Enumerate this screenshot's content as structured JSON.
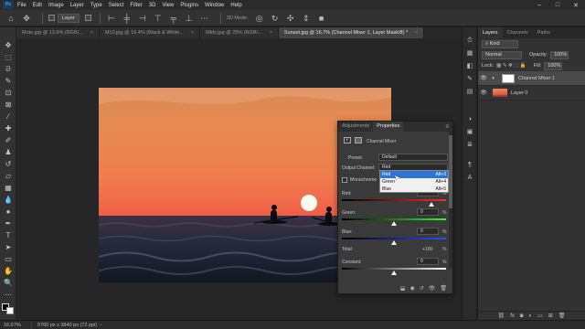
{
  "menubar": {
    "logo": "Ps",
    "items": [
      "File",
      "Edit",
      "Image",
      "Layer",
      "Type",
      "Select",
      "Filter",
      "3D",
      "View",
      "Plugins",
      "Window",
      "Help"
    ],
    "window_controls": [
      "–",
      "□",
      "✕"
    ]
  },
  "options": {
    "auto_select_label": "Layer",
    "mode_3d": "3D Mode:"
  },
  "tabs": [
    {
      "label": "Moto.jpg @ 13.6% (RGB/...",
      "active": false
    },
    {
      "label": "M10.jpg @ 16.4% (Black & White...",
      "active": false
    },
    {
      "label": "Mlds.jpg @ 25% (RGB/...",
      "active": false
    },
    {
      "label": "Sunset.jpg @ 16.7% (Channel Mixer 1, Layer Mask/8) *",
      "active": true
    }
  ],
  "status": {
    "zoom": "16.67%",
    "doc": "5760 px x 3840 px (72 ppi)"
  },
  "layers_panel": {
    "tabs": [
      "Layers",
      "Channels",
      "Paths"
    ],
    "kind": "Kind",
    "blend_mode": "Normal",
    "opacity_label": "Opacity:",
    "opacity_value": "100%",
    "lock_label": "Lock:",
    "fill_label": "Fill:",
    "fill_value": "100%",
    "layers": [
      {
        "name": "Channel Mixer 1",
        "selected": true
      },
      {
        "name": "Layer 0",
        "selected": false
      }
    ]
  },
  "properties": {
    "tabs": [
      "Adjustments",
      "Properties"
    ],
    "adjustment_name": "Channel Mixer",
    "preset_label": "Preset:",
    "preset_value": "Default",
    "output_label": "Output Channel:",
    "output_value": "Red",
    "monochrome_label": "Monochrome",
    "sliders": [
      {
        "label": "Red:",
        "value": "",
        "fraction": 0.86,
        "color": "#ff2a2a"
      },
      {
        "label": "Green:",
        "value": "0",
        "fraction": 0.5,
        "color": "#2aff2a"
      },
      {
        "label": "Blue:",
        "value": "0",
        "fraction": 0.5,
        "color": "#2a4cff"
      }
    ],
    "total_label": "Total:",
    "total_value": "+100",
    "constant_label": "Constant:",
    "constant_value": "0",
    "pct": "%"
  },
  "dropdown": {
    "items": [
      {
        "label": "Red",
        "shortcut": "Alt+3",
        "highlight": true
      },
      {
        "label": "Green",
        "shortcut": "Alt+4",
        "highlight": false
      },
      {
        "label": "Blue",
        "shortcut": "Alt+5",
        "highlight": false
      }
    ]
  },
  "colors": {
    "accent": "#31a8ff",
    "highlight": "#2d74d6"
  }
}
